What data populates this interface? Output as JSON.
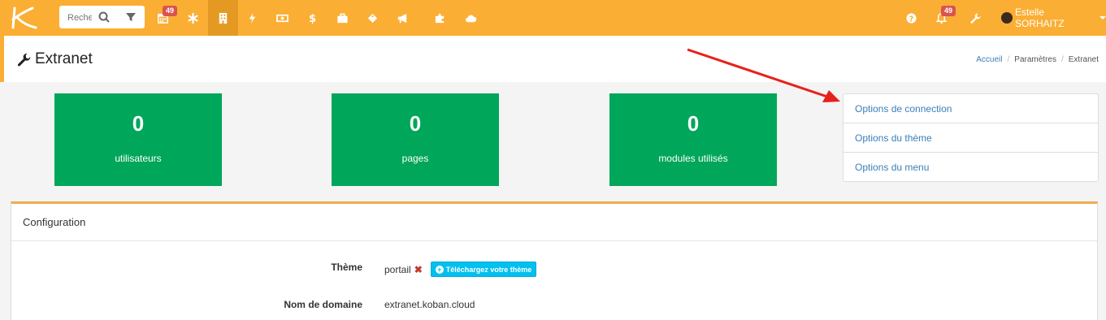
{
  "topbar": {
    "search_placeholder": "Recherche",
    "calendar_badge": "49",
    "notifications_badge": "49",
    "user_name": "Estelle SORHAITZ"
  },
  "page": {
    "title": "Extranet",
    "breadcrumb": {
      "home": "Accueil",
      "sep1": "/",
      "settings": "Paramètres",
      "sep2": "/",
      "current": "Extranet"
    }
  },
  "stats": [
    {
      "value": "0",
      "label": "utilisateurs"
    },
    {
      "value": "0",
      "label": "pages"
    },
    {
      "value": "0",
      "label": "modules utilisés"
    }
  ],
  "options": [
    "Options de connection",
    "Options du thème",
    "Options du menu"
  ],
  "config": {
    "heading": "Configuration",
    "theme_label": "Thème",
    "theme_value": "portail",
    "remove_mark": "✖",
    "upload_button": "Téléchargez votre thème",
    "upload_plus": "+",
    "domain_label": "Nom de domaine",
    "domain_value": "extranet.koban.cloud"
  },
  "colors": {
    "topbar": "#fbae34",
    "stat_green": "#00a65a",
    "link_blue": "#3a7fb8",
    "badge_red": "#d9534f",
    "annotation_arrow": "#e8201a"
  }
}
